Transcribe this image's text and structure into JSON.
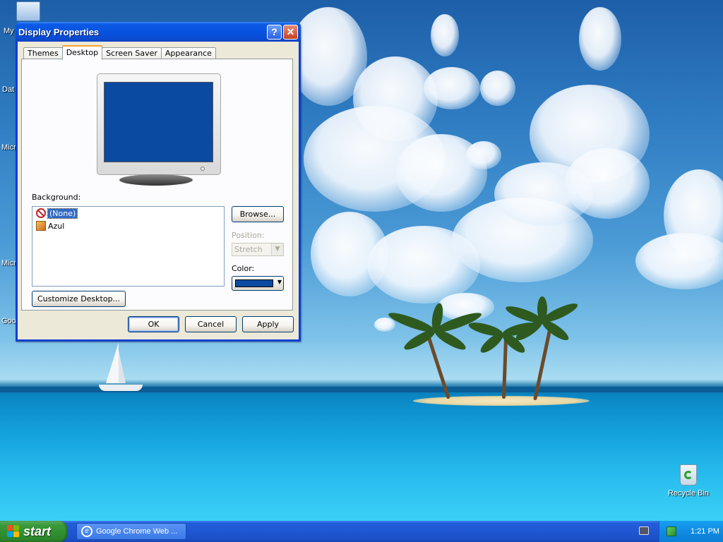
{
  "desktop": {
    "icons": [
      {
        "label": "My"
      },
      {
        "label": "Dat"
      },
      {
        "label": "Micr"
      },
      {
        "label": "Micr"
      },
      {
        "label": "Goo"
      },
      {
        "label": "Recycle Bin"
      }
    ]
  },
  "window": {
    "title": "Display Properties",
    "help_glyph": "?",
    "close_glyph": "✕",
    "tabs": [
      {
        "label": "Themes"
      },
      {
        "label": "Desktop"
      },
      {
        "label": "Screen Saver"
      },
      {
        "label": "Appearance"
      }
    ],
    "active_tab": "Desktop",
    "background_label": "Background:",
    "background_items": [
      {
        "label": "(None)",
        "selected": true
      },
      {
        "label": "Azul",
        "selected": false
      }
    ],
    "browse_label": "Browse...",
    "position_label": "Position:",
    "position_value": "Stretch",
    "color_label": "Color:",
    "color_value": "#0a4aa0",
    "customize_label": "Customize Desktop...",
    "ok_label": "OK",
    "cancel_label": "Cancel",
    "apply_label": "Apply"
  },
  "taskbar": {
    "start_label": "start",
    "tasks": [
      {
        "label": "Google Chrome Web ..."
      }
    ],
    "clock": "1:21 PM"
  }
}
